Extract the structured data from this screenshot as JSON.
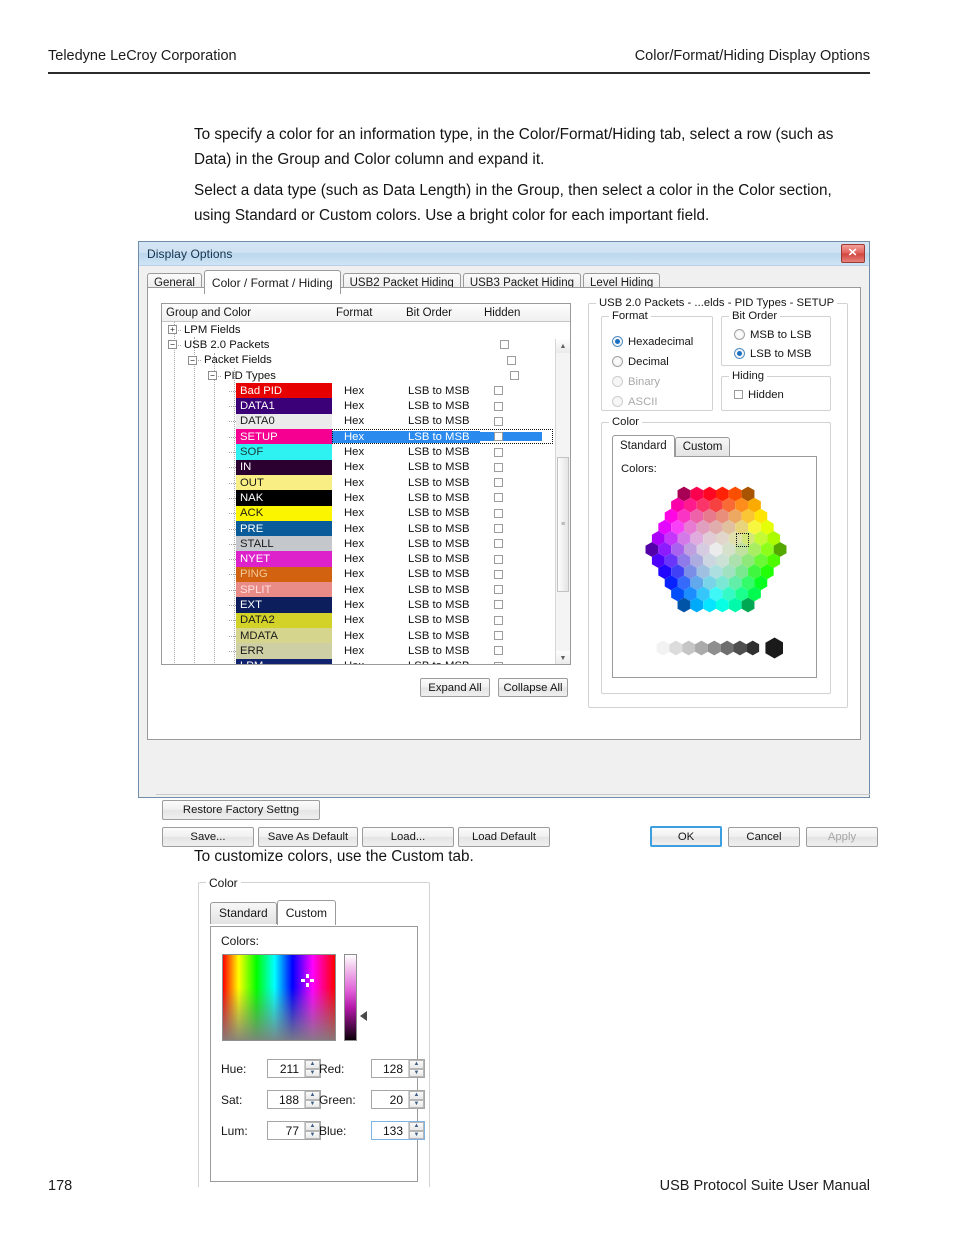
{
  "page": {
    "header_left": "Teledyne LeCroy Corporation",
    "header_right": "Color/Format/Hiding Display Options",
    "footer_left": "178",
    "footer_right": "USB Protocol Suite User Manual",
    "para1": "To specify a color for an information type, in the Color/Format/Hiding tab, select a row (such as Data) in the Group and Color column and expand it.",
    "para2": "Select a data type (such as Data Length) in the Group, then select a color in the Color section, using Standard or Custom colors. Use a bright color for each important field.",
    "para3": "To customize colors, use the Custom tab."
  },
  "dialog": {
    "title": "Display Options",
    "close_glyph": "✕",
    "tabs": [
      {
        "label": "General",
        "active": false
      },
      {
        "label": "Color / Format / Hiding",
        "active": true
      },
      {
        "label": "USB2 Packet Hiding",
        "active": false
      },
      {
        "label": "USB3 Packet Hiding",
        "active": false
      },
      {
        "label": "Level Hiding",
        "active": false
      }
    ],
    "tree": {
      "columns": [
        "Group and Color",
        "Format",
        "Bit Order",
        "Hidden"
      ],
      "nodes": [
        {
          "type": "node",
          "label": "LPM Fields",
          "indent": 0,
          "expander": "+",
          "hidden_box": false
        },
        {
          "type": "node",
          "label": "USB 2.0 Packets",
          "indent": 0,
          "expander": "−",
          "hidden_box": true
        },
        {
          "type": "node",
          "label": "Packet Fields",
          "indent": 1,
          "expander": "−",
          "hidden_box": true
        },
        {
          "type": "node",
          "label": "PID Types",
          "indent": 2,
          "expander": "−",
          "hidden_box": true
        },
        {
          "type": "color",
          "label": "Bad PID",
          "bg": "#e60000",
          "fg": "#ffffff",
          "format": "Hex",
          "bit_order": "LSB to MSB",
          "selected": false
        },
        {
          "type": "color",
          "label": "DATA1",
          "bg": "#3b0077",
          "fg": "#ffffff",
          "format": "Hex",
          "bit_order": "LSB to MSB",
          "selected": false
        },
        {
          "type": "color",
          "label": "DATA0",
          "bg": "#ebebeb",
          "fg": "#1a1a1a",
          "format": "Hex",
          "bit_order": "LSB to MSB",
          "selected": false
        },
        {
          "type": "color",
          "label": "SETUP",
          "bg": "#f50090",
          "fg": "#ffffff",
          "format": "Hex",
          "bit_order": "LSB to MSB",
          "selected": true
        },
        {
          "type": "color",
          "label": "SOF",
          "bg": "#2ef2f2",
          "fg": "#1a3a3a",
          "format": "Hex",
          "bit_order": "LSB to MSB",
          "selected": false
        },
        {
          "type": "color",
          "label": "IN",
          "bg": "#2b0030",
          "fg": "#ffffff",
          "format": "Hex",
          "bit_order": "LSB to MSB",
          "selected": false
        },
        {
          "type": "color",
          "label": "OUT",
          "bg": "#f8ee84",
          "fg": "#1a1a1a",
          "format": "Hex",
          "bit_order": "LSB to MSB",
          "selected": false
        },
        {
          "type": "color",
          "label": "NAK",
          "bg": "#000000",
          "fg": "#ffffff",
          "format": "Hex",
          "bit_order": "LSB to MSB",
          "selected": false
        },
        {
          "type": "color",
          "label": "ACK",
          "bg": "#fcf500",
          "fg": "#1a1a1a",
          "format": "Hex",
          "bit_order": "LSB to MSB",
          "selected": false
        },
        {
          "type": "color",
          "label": "PRE",
          "bg": "#0a5b99",
          "fg": "#ffffff",
          "format": "Hex",
          "bit_order": "LSB to MSB",
          "selected": false
        },
        {
          "type": "color",
          "label": "STALL",
          "bg": "#c4c8cc",
          "fg": "#1a1a1a",
          "format": "Hex",
          "bit_order": "LSB to MSB",
          "selected": false
        },
        {
          "type": "color",
          "label": "NYET",
          "bg": "#dd22cc",
          "fg": "#ffffff",
          "format": "Hex",
          "bit_order": "LSB to MSB",
          "selected": false
        },
        {
          "type": "color",
          "label": "PING",
          "bg": "#d2620f",
          "fg": "#f3c99a",
          "format": "Hex",
          "bit_order": "LSB to MSB",
          "selected": false
        },
        {
          "type": "color",
          "label": "SPLIT",
          "bg": "#e98b86",
          "fg": "#ffe0e0",
          "format": "Hex",
          "bit_order": "LSB to MSB",
          "selected": false
        },
        {
          "type": "color",
          "label": "EXT",
          "bg": "#0c1f5c",
          "fg": "#ffffff",
          "format": "Hex",
          "bit_order": "LSB to MSB",
          "selected": false
        },
        {
          "type": "color",
          "label": "DATA2",
          "bg": "#d2d229",
          "fg": "#1a1a1a",
          "format": "Hex",
          "bit_order": "LSB to MSB",
          "selected": false
        },
        {
          "type": "color",
          "label": "MDATA",
          "bg": "#d5d58e",
          "fg": "#1a1a1a",
          "format": "Hex",
          "bit_order": "LSB to MSB",
          "selected": false
        },
        {
          "type": "color",
          "label": "ERR",
          "bg": "#cfcfa5",
          "fg": "#1a1a1a",
          "format": "Hex",
          "bit_order": "LSB to MSB",
          "selected": false
        },
        {
          "type": "color",
          "label": "LPM",
          "bg": "#11236e",
          "fg": "#ffffff",
          "format": "Hex",
          "bit_order": "LSB to MSB",
          "selected": false
        }
      ]
    },
    "expand_all_label": "Expand All",
    "collapse_all_label": "Collapse All",
    "properties": {
      "group_title": "USB 2.0 Packets - ...elds - PID Types - SETUP",
      "format": {
        "title": "Format",
        "options": [
          {
            "label": "Hexadecimal",
            "selected": true,
            "enabled": true
          },
          {
            "label": "Decimal",
            "selected": false,
            "enabled": true
          },
          {
            "label": "Binary",
            "selected": false,
            "enabled": false
          },
          {
            "label": "ASCII",
            "selected": false,
            "enabled": false
          }
        ]
      },
      "bit_order": {
        "title": "Bit Order",
        "options": [
          {
            "label": "MSB to LSB",
            "selected": false,
            "enabled": true
          },
          {
            "label": "LSB to MSB",
            "selected": true,
            "enabled": true
          }
        ]
      },
      "hiding": {
        "title": "Hiding",
        "checkbox_label": "Hidden",
        "checked": false
      },
      "color": {
        "title": "Color",
        "tabs": [
          {
            "label": "Standard",
            "active": true
          },
          {
            "label": "Custom",
            "active": false
          }
        ],
        "colors_label": "Colors:"
      }
    },
    "buttons": {
      "restore": "Restore Factory Settng",
      "save": "Save...",
      "save_as_default": "Save As Default",
      "load": "Load...",
      "load_default": "Load Default",
      "ok": "OK",
      "cancel": "Cancel",
      "apply": "Apply"
    }
  },
  "custom_panel": {
    "group_title": "Color",
    "tabs": [
      {
        "label": "Standard",
        "active": false
      },
      {
        "label": "Custom",
        "active": true
      }
    ],
    "colors_label": "Colors:",
    "fields": [
      {
        "name": "hue",
        "label": "Hue:",
        "value": "211",
        "focused": false
      },
      {
        "name": "sat",
        "label": "Sat:",
        "value": "188",
        "focused": false
      },
      {
        "name": "lum",
        "label": "Lum:",
        "value": "77",
        "focused": false
      },
      {
        "name": "red",
        "label": "Red:",
        "value": "128",
        "focused": false
      },
      {
        "name": "green",
        "label": "Green:",
        "value": "20",
        "focused": false
      },
      {
        "name": "blue",
        "label": "Blue:",
        "value": "133",
        "focused": true
      }
    ]
  },
  "theme": {
    "accent": "#2a8aee",
    "title_bar": "#cfe1f2",
    "default_button_border": "#3c9fe0"
  }
}
